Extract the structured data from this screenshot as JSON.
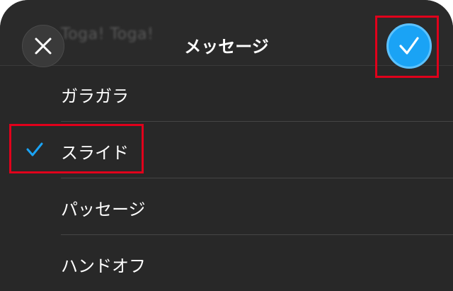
{
  "header": {
    "background_text": "Toga! Toga!",
    "title": "メッセージ",
    "close_icon": "close-icon",
    "confirm_icon": "checkmark-icon"
  },
  "options": [
    {
      "label": "ガラガラ",
      "selected": false
    },
    {
      "label": "スライド",
      "selected": true
    },
    {
      "label": "パッセージ",
      "selected": false
    },
    {
      "label": "ハンドオフ",
      "selected": false
    }
  ],
  "colors": {
    "accent": "#1aa3f5",
    "highlight_frame": "#e0001b",
    "background": "#282828"
  }
}
